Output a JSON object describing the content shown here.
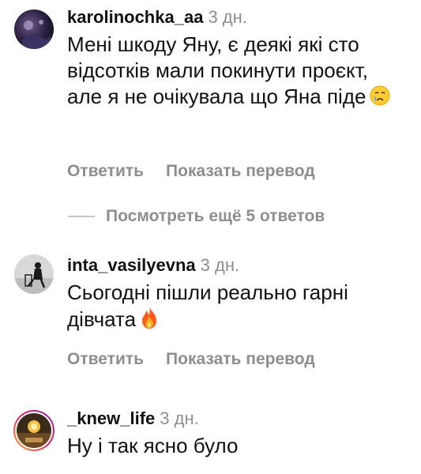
{
  "comments": [
    {
      "username": "karolinochka_aa",
      "time": "3 дн.",
      "text": "Мені шкоду Яну, є деякі які сто відсотків мали покинути проєкт, але я не очікувала що Яна піде",
      "emoji": "crying-face",
      "reply_label": "Ответить",
      "translate_label": "Показать перевод"
    },
    {
      "username": "inta_vasilyevna",
      "time": "3 дн.",
      "text": "Сьогодні пішли реально гарні дівчата",
      "emoji": "fire",
      "reply_label": "Ответить",
      "translate_label": "Показать перевод"
    },
    {
      "username": "_knew_life",
      "time": "3 дн.",
      "text": "Ну і так ясно було"
    }
  ],
  "view_more_label": "Посмотреть ещё 5 ответов"
}
